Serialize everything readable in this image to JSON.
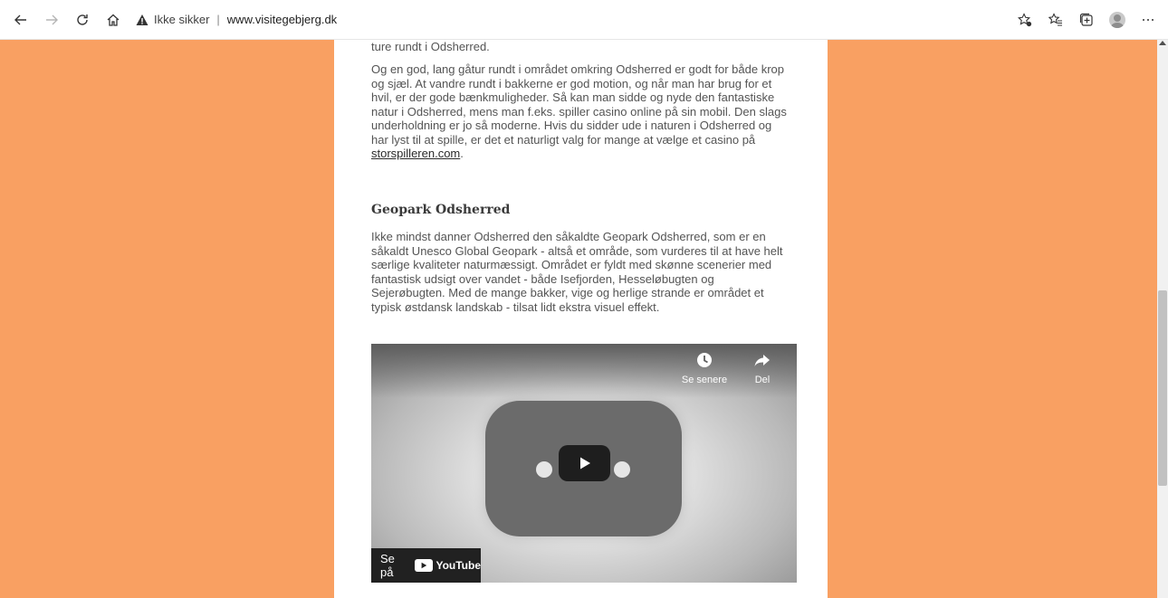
{
  "browser": {
    "security_label": "Ikke sikker",
    "separator": "|",
    "url": "www.visitegebjerg.dk",
    "icons": [
      "back-icon",
      "forward-icon",
      "refresh-icon",
      "home-icon",
      "warning-icon",
      "favorite-add-icon",
      "favorites-icon",
      "collections-icon",
      "profile-icon",
      "more-icon"
    ]
  },
  "article": {
    "p0": "ture rundt i Odsherred.",
    "p1_text": "Og en god, lang gåtur rundt i området omkring Odsherred er godt for både krop og sjæl. At vandre rundt i bakkerne er god motion, og når man har brug for et hvil, er der gode bænkmuligheder. Så kan man sidde og nyde den fantastiske natur i Odsherred, mens man f.eks. spiller casino online på sin mobil. Den slags underholdning er jo så moderne. Hvis du sidder ude i naturen i Odsherred og har lyst til at spille, er det et naturligt valg for mange at vælge et casino på ",
    "p1_link": "storspilleren.com",
    "p1_end": ".",
    "heading": "Geopark Odsherred",
    "p2": "Ikke mindst danner Odsherred den såkaldte Geopark Odsherred, som er en såkaldt Unesco Global Geopark - altså et område, som vurderes til at have helt særlige kvaliteter naturmæssigt. Området er fyldt med skønne scenerier med fantastisk udsigt over vandet - både Isefjorden, Hesseløbugten og Sejerøbugten. Med de mange bakker, vige og herlige strande er området et typisk østdansk landskab - tilsat lidt ekstra visuel effekt."
  },
  "video": {
    "watch_later": "Se senere",
    "share": "Del",
    "watch_on": "Se på",
    "youtube": "YouTube"
  }
}
